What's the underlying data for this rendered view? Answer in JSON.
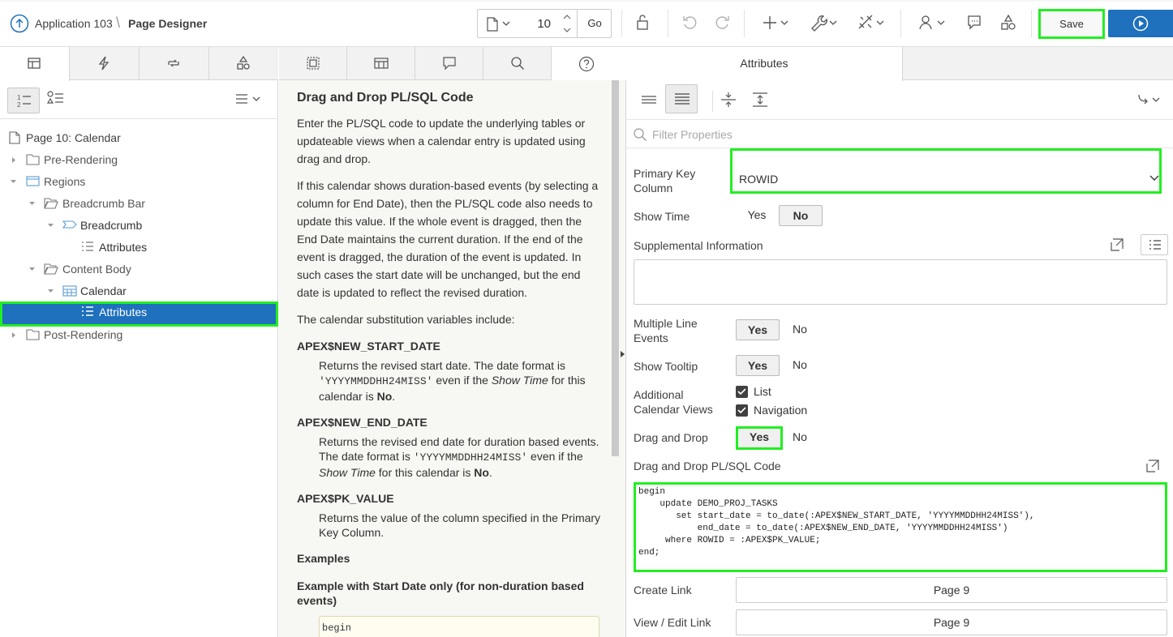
{
  "header": {
    "app_name": "Application 103",
    "separator": "\\",
    "current_page": "Page Designer",
    "page_number": "10",
    "go_label": "Go",
    "save_label": "Save"
  },
  "left_panel": {
    "tree": [
      {
        "label": "Page 10: Calendar"
      },
      {
        "label": "Pre-Rendering"
      },
      {
        "label": "Regions"
      },
      {
        "label": "Breadcrumb Bar"
      },
      {
        "label": "Breadcrumb"
      },
      {
        "label": "Attributes"
      },
      {
        "label": "Content Body"
      },
      {
        "label": "Calendar"
      },
      {
        "label": "Attributes"
      },
      {
        "label": "Post-Rendering"
      }
    ]
  },
  "help": {
    "title": "Drag and Drop PL/SQL Code",
    "p1": "Enter the PL/SQL code to update the underlying tables or updateable views when a calendar entry is updated using drag and drop.",
    "p2": "If this calendar shows duration-based events (by selecting a column for End Date), then the PL/SQL code also needs to update this value. If the whole event is dragged, then the End Date maintains the current duration. If the end of the event is dragged, the duration of the event is updated. In such cases the start date will be unchanged, but the end date is updated to reflect the revised duration.",
    "p3": "The calendar substitution variables include:",
    "terms": [
      {
        "name": "APEX$NEW_START_DATE",
        "pre": "Returns the revised start date. The date format is ",
        "code": "'YYYYMMDDHH24MISS'",
        "mid": " even if the ",
        "em": "Show Time",
        "post": " for this calendar is ",
        "strong": "No",
        "end": "."
      },
      {
        "name": "APEX$NEW_END_DATE",
        "pre": "Returns the revised end date for duration based events. The date format is ",
        "code": "'YYYYMMDDHH24MISS'",
        "mid": " even if the ",
        "em": "Show Time",
        "post": " for this calendar is ",
        "strong": "No",
        "end": "."
      },
      {
        "name": "APEX$PK_VALUE",
        "text": "Returns the value of the column specified in the Primary Key Column."
      }
    ],
    "examples_heading": "Examples",
    "example1_heading": "Example with Start Date only (for non-duration based events)",
    "example1_code": "begin"
  },
  "attributes": {
    "tab_label": "Attributes",
    "filter_placeholder": "Filter Properties",
    "primary_key_label": "Primary Key Column",
    "primary_key_value": "ROWID",
    "show_time_label": "Show Time",
    "supplemental_label": "Supplemental Information",
    "multiple_line_label": "Multiple Line Events",
    "show_tooltip_label": "Show Tooltip",
    "additional_views_label": "Additional Calendar Views",
    "view_list": "List",
    "view_navigation": "Navigation",
    "drag_drop_label": "Drag and Drop",
    "drag_drop_code_label": "Drag and Drop PL/SQL Code",
    "yes": "Yes",
    "no": "No",
    "code_lines": [
      "begin",
      "    update DEMO_PROJ_TASKS",
      "       set start_date = to_date(:APEX$NEW_START_DATE, 'YYYYMMDDHH24MISS'),",
      "           end_date = to_date(:APEX$NEW_END_DATE, 'YYYYMMDDHH24MISS')",
      "     where ROWID = :APEX$PK_VALUE;",
      "end;"
    ],
    "create_link_label": "Create Link",
    "create_link_value": "Page 9",
    "view_edit_link_label": "View / Edit Link",
    "view_edit_link_value": "Page 9"
  },
  "colors": {
    "accent_blue": "#1f70bd",
    "highlight_green": "#22ee22"
  },
  "icons": {
    "app_up": "arrow-up-circle-icon",
    "page": "page-icon",
    "lock": "lock-icon",
    "undo": "undo-icon",
    "redo": "redo-icon",
    "create": "plus-icon",
    "utilities": "wrench-icon",
    "shared": "shared-components-icon",
    "team": "team-icon",
    "comment": "comment-icon",
    "components": "shapes-icon",
    "run": "play-icon"
  }
}
